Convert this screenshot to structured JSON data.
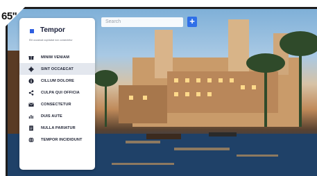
{
  "screen_size_label": "65\"",
  "search": {
    "placeholder": "Search"
  },
  "add_button": {
    "symbol": "+"
  },
  "sidebar": {
    "title": "Tempor",
    "subtitle": "Elit occaecat cupidatat non consectetur",
    "items": [
      {
        "label": "MINIM VENIAM",
        "icon": "gift-icon",
        "active": false
      },
      {
        "label": "SINT OCCAECAT",
        "icon": "gear-icon",
        "active": true
      },
      {
        "label": "CILLUM DOLORE",
        "icon": "info-icon",
        "active": false
      },
      {
        "label": "CULPA QUI OFFICIA",
        "icon": "share-icon",
        "active": false
      },
      {
        "label": "CONSECTETUR",
        "icon": "mail-icon",
        "active": false
      },
      {
        "label": "DUIS AUTE",
        "icon": "bar-chart-icon",
        "active": false
      },
      {
        "label": "NULLA PARIATUR",
        "icon": "document-icon",
        "active": false
      },
      {
        "label": "TEMPOR INCIDIDUNT",
        "icon": "globe-icon",
        "active": false
      }
    ]
  },
  "colors": {
    "accent": "#2f5fe0",
    "add_button": "#2f6fe8",
    "active_item_bg": "#e3e7ee"
  }
}
